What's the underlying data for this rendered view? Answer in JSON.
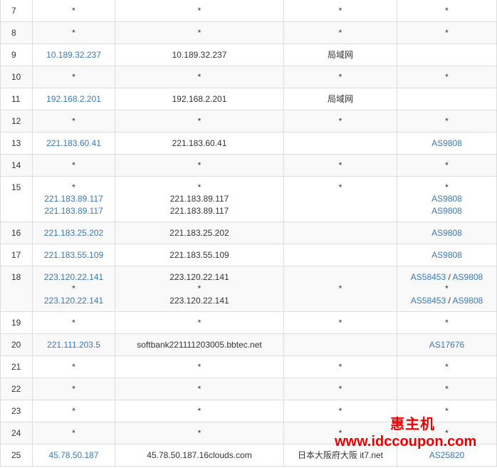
{
  "rows": [
    {
      "hop": "7",
      "ip": [
        "*"
      ],
      "host": [
        "*"
      ],
      "loc": "*",
      "as": [
        [
          "*"
        ]
      ],
      "h": 31
    },
    {
      "hop": "8",
      "ip": [
        "*"
      ],
      "host": [
        "*"
      ],
      "loc": "*",
      "as": [
        [
          "*"
        ]
      ],
      "h": 31
    },
    {
      "hop": "9",
      "ip": [
        "10.189.32.237"
      ],
      "host": [
        "10.189.32.237"
      ],
      "loc": "局域网",
      "as": [
        []
      ],
      "h": 31
    },
    {
      "hop": "10",
      "ip": [
        "*"
      ],
      "host": [
        "*"
      ],
      "loc": "*",
      "as": [
        [
          "*"
        ]
      ],
      "h": 31
    },
    {
      "hop": "11",
      "ip": [
        "192.168.2.201"
      ],
      "host": [
        "192.168.2.201"
      ],
      "loc": "局域网",
      "as": [
        []
      ],
      "h": 31
    },
    {
      "hop": "12",
      "ip": [
        "*"
      ],
      "host": [
        "*"
      ],
      "loc": "*",
      "as": [
        [
          "*"
        ]
      ],
      "h": 31
    },
    {
      "hop": "13",
      "ip": [
        "221.183.60.41"
      ],
      "host": [
        "221.183.60.41"
      ],
      "loc": "",
      "as": [
        [
          "AS9808"
        ]
      ],
      "h": 31
    },
    {
      "hop": "14",
      "ip": [
        "*"
      ],
      "host": [
        "*"
      ],
      "loc": "*",
      "as": [
        [
          "*"
        ]
      ],
      "h": 31
    },
    {
      "hop": "15",
      "ip": [
        "*",
        "221.183.89.117",
        "221.183.89.117"
      ],
      "host": [
        "*",
        "221.183.89.117",
        "221.183.89.117"
      ],
      "loc": "*",
      "locTop": true,
      "as": [
        [
          "*"
        ],
        [
          "AS9808"
        ],
        [
          "AS9808"
        ]
      ],
      "h": 64
    },
    {
      "hop": "16",
      "ip": [
        "221.183.25.202"
      ],
      "host": [
        "221.183.25.202"
      ],
      "loc": "",
      "as": [
        [
          "AS9808"
        ]
      ],
      "h": 31
    },
    {
      "hop": "17",
      "ip": [
        "221.183.55.109"
      ],
      "host": [
        "221.183.55.109"
      ],
      "loc": "",
      "as": [
        [
          "AS9808"
        ]
      ],
      "h": 31
    },
    {
      "hop": "18",
      "ip": [
        "223.120.22.141",
        "*",
        "223.120.22.141"
      ],
      "host": [
        "223.120.22.141",
        "*",
        "223.120.22.141"
      ],
      "loc": "*",
      "as": [
        [
          "AS58453",
          "AS9808"
        ],
        [
          "*"
        ],
        [
          "AS58453",
          "AS9808"
        ]
      ],
      "h": 64
    },
    {
      "hop": "19",
      "ip": [
        "*"
      ],
      "host": [
        "*"
      ],
      "loc": "*",
      "as": [
        [
          "*"
        ]
      ],
      "h": 31
    },
    {
      "hop": "20",
      "ip": [
        "221.111.203.5"
      ],
      "host": [
        "softbank221111203005.bbtec.net"
      ],
      "loc": "",
      "as": [
        [
          "AS17676"
        ]
      ],
      "h": 31
    },
    {
      "hop": "21",
      "ip": [
        "*"
      ],
      "host": [
        "*"
      ],
      "loc": "*",
      "as": [
        [
          "*"
        ]
      ],
      "h": 31
    },
    {
      "hop": "22",
      "ip": [
        "*"
      ],
      "host": [
        "*"
      ],
      "loc": "*",
      "as": [
        [
          "*"
        ]
      ],
      "h": 31
    },
    {
      "hop": "23",
      "ip": [
        "*"
      ],
      "host": [
        "*"
      ],
      "loc": "*",
      "as": [
        [
          "*"
        ]
      ],
      "h": 31
    },
    {
      "hop": "24",
      "ip": [
        "*"
      ],
      "host": [
        "*"
      ],
      "loc": "*",
      "as": [
        [
          "*"
        ]
      ],
      "h": 31
    },
    {
      "hop": "25",
      "ip": [
        "45.78.50.187"
      ],
      "host": [
        "45.78.50.187.16clouds.com"
      ],
      "loc": "日本大阪府大阪 it7.net",
      "as": [
        [
          "AS25820"
        ]
      ],
      "h": 31
    }
  ],
  "as_separator": "/",
  "watermark": {
    "title": "惠主机",
    "url": "www.idccoupon.com"
  },
  "colors": {
    "link": "#3a78b5",
    "border": "#dcdcdc",
    "watermark": "#ee0000"
  }
}
